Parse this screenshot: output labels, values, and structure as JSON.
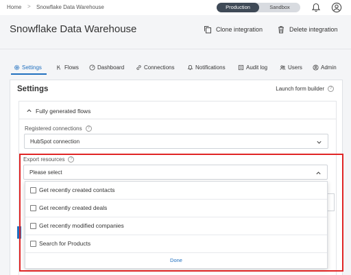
{
  "breadcrumb": {
    "home": "Home",
    "separator": ">",
    "current": "Snowflake Data Warehouse"
  },
  "environment": {
    "active": "Production",
    "inactive": "Sandbox"
  },
  "header": {
    "title": "Snowflake Data Warehouse",
    "clone_label": "Clone integration",
    "delete_label": "Delete integration"
  },
  "tabs": [
    {
      "label": "Settings",
      "icon": "gear-icon"
    },
    {
      "label": "Flows",
      "icon": "flows-icon"
    },
    {
      "label": "Dashboard",
      "icon": "dashboard-icon"
    },
    {
      "label": "Connections",
      "icon": "link-icon"
    },
    {
      "label": "Notifications",
      "icon": "bell-icon"
    },
    {
      "label": "Audit log",
      "icon": "audit-log-icon"
    },
    {
      "label": "Users",
      "icon": "users-icon"
    },
    {
      "label": "Admin",
      "icon": "admin-icon"
    }
  ],
  "settings": {
    "title": "Settings",
    "launch_form_builder": "Launch form builder",
    "section_title": "Fully generated flows",
    "registered_connections_label": "Registered connections",
    "registered_connections_value": "HubSpot connection",
    "export_resources_label": "Export resources",
    "export_resources_placeholder": "Please select"
  },
  "dropdown": {
    "options": [
      {
        "label": "Get recently created contacts",
        "checked": false
      },
      {
        "label": "Get recently created deals",
        "checked": false
      },
      {
        "label": "Get recently modified companies",
        "checked": false
      },
      {
        "label": "Search for Products",
        "checked": false
      }
    ],
    "done_label": "Done"
  },
  "colors": {
    "accent": "#1f6fbf",
    "highlight": "#e02424",
    "toggle_active": "#3f4a57"
  }
}
